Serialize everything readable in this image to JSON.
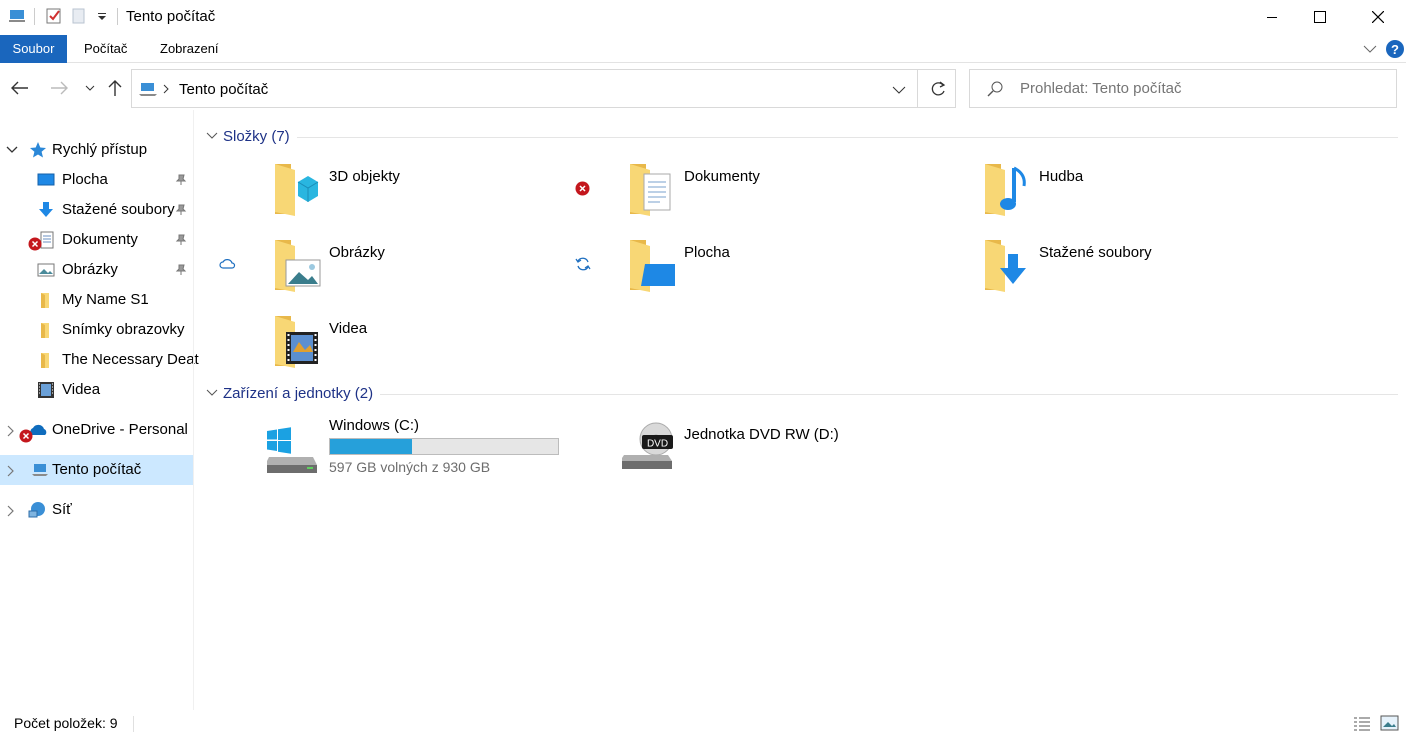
{
  "window": {
    "title": "Tento počítač"
  },
  "ribbon": {
    "tabs": [
      {
        "label": "Soubor"
      },
      {
        "label": "Počítač"
      },
      {
        "label": "Zobrazení"
      }
    ]
  },
  "address": {
    "path_item": "Tento počítač"
  },
  "search": {
    "placeholder": "Prohledat: Tento počítač"
  },
  "sidebar": {
    "quick_access": "Rychlý přístup",
    "items": [
      {
        "label": "Plocha",
        "pinned": true
      },
      {
        "label": "Stažené soubory",
        "pinned": true
      },
      {
        "label": "Dokumenty",
        "pinned": true
      },
      {
        "label": "Obrázky",
        "pinned": true
      },
      {
        "label": "My Name S1"
      },
      {
        "label": "Snímky obrazovky"
      },
      {
        "label": "The Necessary Deat"
      },
      {
        "label": "Videa"
      }
    ],
    "onedrive": "OneDrive - Personal",
    "this_pc": "Tento počítač",
    "network": "Síť"
  },
  "content": {
    "folders_header": "Složky (7)",
    "folders": [
      {
        "name": "3D objekty"
      },
      {
        "name": "Dokumenty"
      },
      {
        "name": "Hudba"
      },
      {
        "name": "Obrázky"
      },
      {
        "name": "Plocha"
      },
      {
        "name": "Stažené soubory"
      },
      {
        "name": "Videa"
      }
    ],
    "devices_header": "Zařízení a jednotky (2)",
    "drives": [
      {
        "name": "Windows (C:)",
        "free_text": "597 GB volných z 930 GB",
        "used_fraction": 0.358
      },
      {
        "name": "Jednotka DVD RW (D:)"
      }
    ]
  },
  "status": {
    "count": "Počet položek: 9"
  },
  "colors": {
    "accent": "#1a66bd",
    "selection": "#cce8ff",
    "group_header": "#1e3287",
    "drive_bar": "#26a0da",
    "folder": "#f8d775"
  }
}
